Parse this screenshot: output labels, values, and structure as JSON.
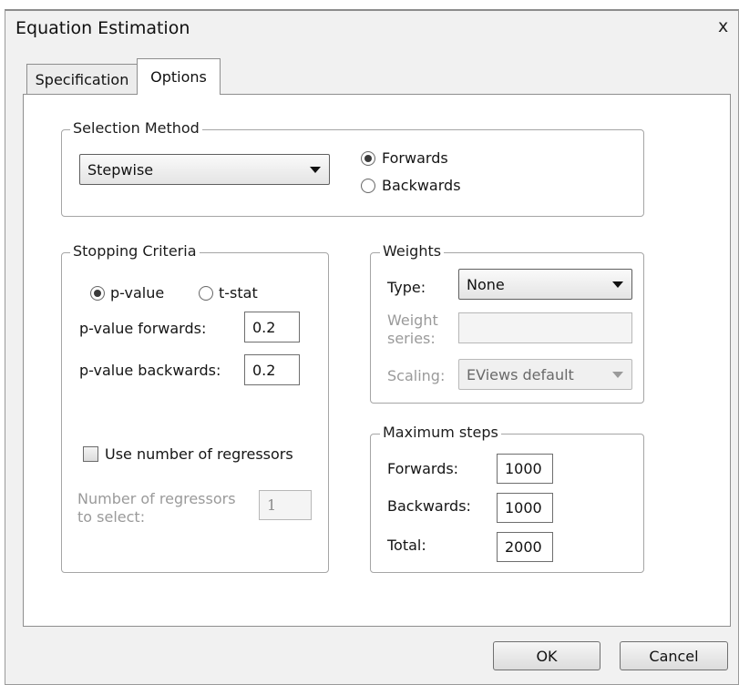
{
  "window": {
    "title": "Equation Estimation",
    "close_glyph": "x"
  },
  "tabs": [
    {
      "label": "Specification"
    },
    {
      "label": "Options"
    }
  ],
  "selection_method": {
    "legend": "Selection Method",
    "method_value": "Stepwise",
    "direction_options": [
      {
        "label": "Forwards",
        "selected": true
      },
      {
        "label": "Backwards",
        "selected": false
      }
    ]
  },
  "stopping_criteria": {
    "legend": "Stopping Criteria",
    "criterion_options": [
      {
        "label": "p-value",
        "selected": true
      },
      {
        "label": "t-stat",
        "selected": false
      }
    ],
    "pvalue_forwards_label": "p-value forwards:",
    "pvalue_forwards_value": "0.2",
    "pvalue_backwards_label": "p-value backwards:",
    "pvalue_backwards_value": "0.2",
    "use_regressors_label": "Use number of regressors",
    "use_regressors_checked": false,
    "num_regressors_label_line1": "Number of regressors",
    "num_regressors_label_line2": "to select:",
    "num_regressors_value": "1"
  },
  "weights": {
    "legend": "Weights",
    "type_label": "Type:",
    "type_value": "None",
    "series_label_line1": "Weight",
    "series_label_line2": "series:",
    "series_value": "",
    "scaling_label": "Scaling:",
    "scaling_value": "EViews default"
  },
  "max_steps": {
    "legend": "Maximum steps",
    "forwards_label": "Forwards:",
    "forwards_value": "1000",
    "backwards_label": "Backwards:",
    "backwards_value": "1000",
    "total_label": "Total:",
    "total_value": "2000"
  },
  "buttons": {
    "ok_label": "OK",
    "cancel_label": "Cancel"
  }
}
